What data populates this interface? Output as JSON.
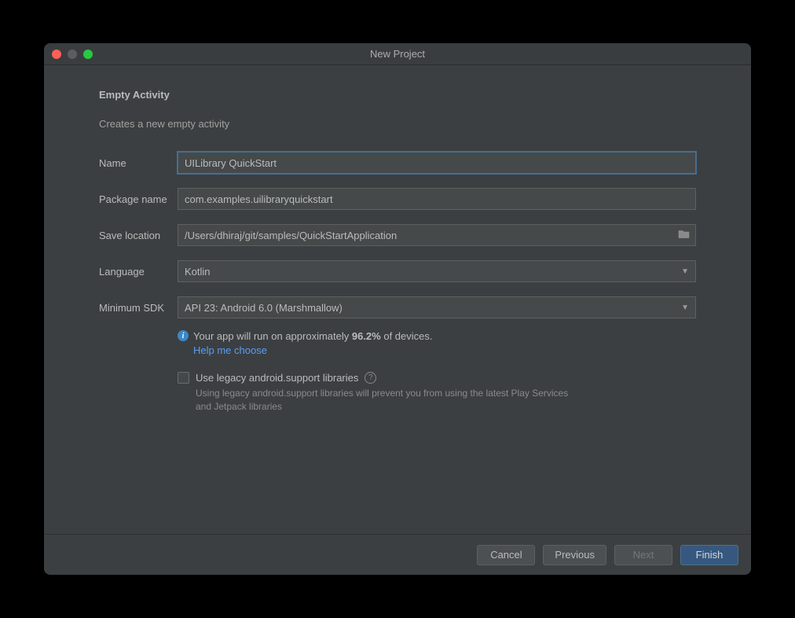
{
  "window": {
    "title": "New Project"
  },
  "form": {
    "heading": "Empty Activity",
    "subheading": "Creates a new empty activity",
    "name": {
      "label": "Name",
      "value": "UILibrary QuickStart"
    },
    "package": {
      "label": "Package name",
      "value": "com.examples.uilibraryquickstart"
    },
    "saveLocation": {
      "label": "Save location",
      "value": "/Users/dhiraj/git/samples/QuickStartApplication"
    },
    "language": {
      "label": "Language",
      "value": "Kotlin"
    },
    "minSdk": {
      "label": "Minimum SDK",
      "value": "API 23: Android 6.0 (Marshmallow)"
    },
    "info": {
      "prefix": "Your app will run on approximately ",
      "percent": "96.2%",
      "suffix": " of devices.",
      "helpLink": "Help me choose"
    },
    "legacy": {
      "label": "Use legacy android.support libraries",
      "hint": "Using legacy android.support libraries will prevent you from using the latest Play Services and Jetpack libraries"
    }
  },
  "footer": {
    "cancel": "Cancel",
    "previous": "Previous",
    "next": "Next",
    "finish": "Finish"
  }
}
